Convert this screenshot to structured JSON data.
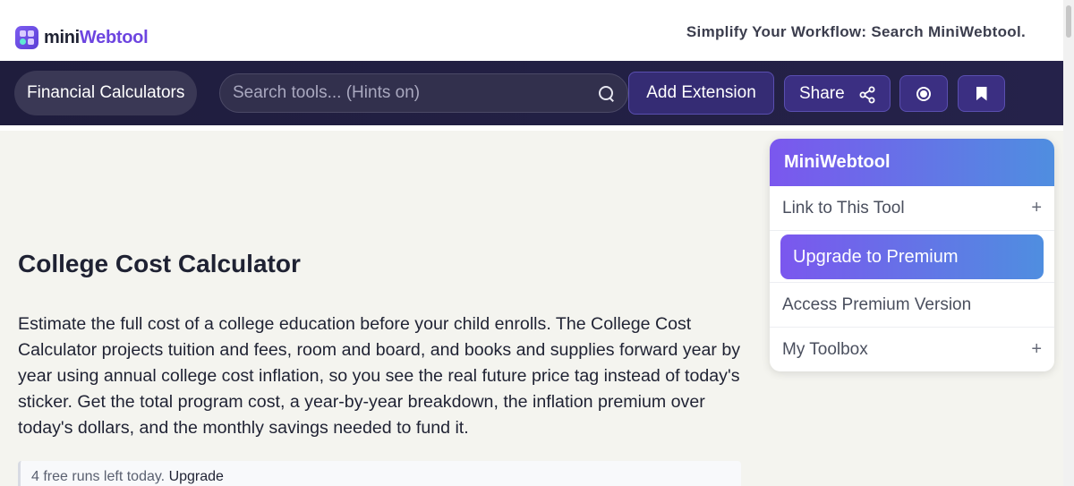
{
  "header": {
    "logo_part1": "mini",
    "logo_part2": "Webtool",
    "tagline": "Simplify Your Workflow: Search MiniWebtool."
  },
  "nav": {
    "category": "Financial Calculators",
    "search_placeholder": "Search tools... (Hints on)",
    "add_extension": "Add Extension",
    "share": "Share"
  },
  "main": {
    "title": "College Cost Calculator",
    "intro": "Estimate the full cost of a college education before your child enrolls. The College Cost Calculator projects tuition and fees, room and board, and books and supplies forward year by year using annual college cost inflation, so you see the real future price tag instead of today's sticker. Get the total program cost, a year-by-year breakdown, the inflation premium over today's dollars, and the monthly savings needed to fund it.",
    "runs_text": "4 free runs left today.",
    "runs_link": "Upgrade"
  },
  "panel": {
    "title": "MiniWebtool",
    "link_to_tool": "Link to This Tool",
    "upgrade": "Upgrade to Premium",
    "access_premium": "Access Premium Version",
    "toolbox": "My Toolbox",
    "plus": "+"
  },
  "colors": {
    "navbar": "#1f1d3d",
    "accent_purple": "#7b57ee",
    "accent_blue": "#4f8ee0",
    "background": "#f4f4ef"
  },
  "icons": [
    "logo-grid-icon",
    "search-icon",
    "share-icon",
    "record-icon",
    "bookmark-icon",
    "plus-icon"
  ]
}
